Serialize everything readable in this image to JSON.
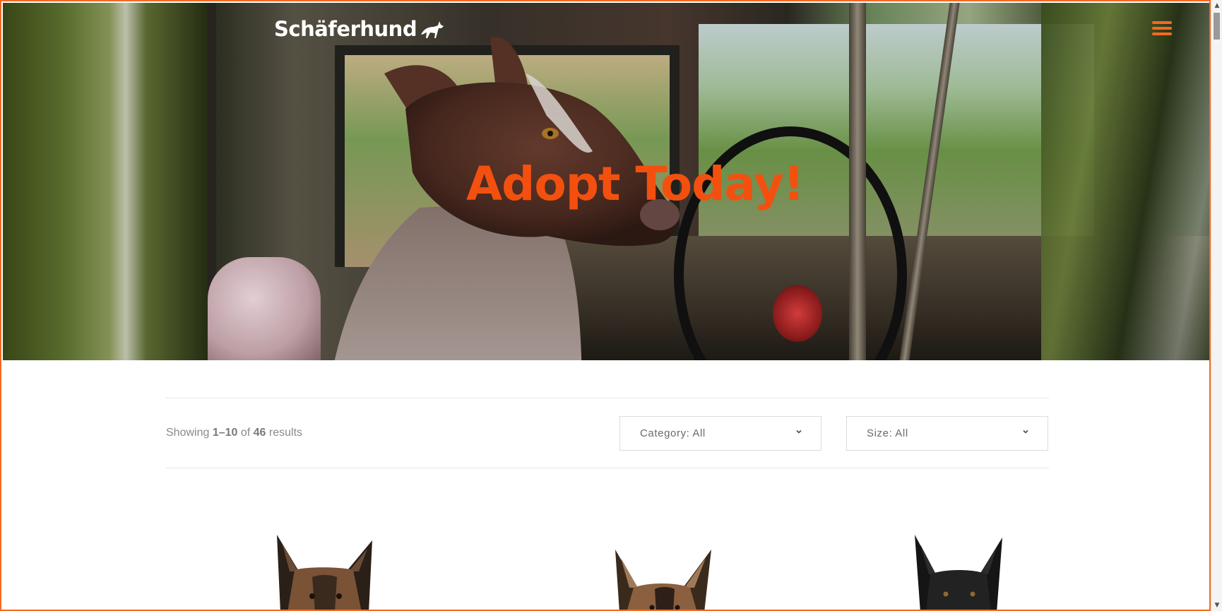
{
  "brand": {
    "name": "Schäferhund",
    "accent": "#f36a21"
  },
  "header": {
    "menu_icon": "hamburger-menu-icon"
  },
  "hero": {
    "title": "Adopt Today!",
    "title_color": "#f3500f"
  },
  "results": {
    "prefix": "Showing ",
    "range": "1–10",
    "of": " of ",
    "total": "46",
    "suffix": " results"
  },
  "filters": {
    "category": {
      "label": "Category: All",
      "icon": "chevron-down-icon"
    },
    "size": {
      "label": "Size: All",
      "icon": "chevron-down-icon"
    }
  },
  "products": [
    {
      "image": "german-shepherd-photo"
    },
    {
      "image": "german-shepherd-photo"
    },
    {
      "image": "black-shepherd-photo"
    }
  ]
}
